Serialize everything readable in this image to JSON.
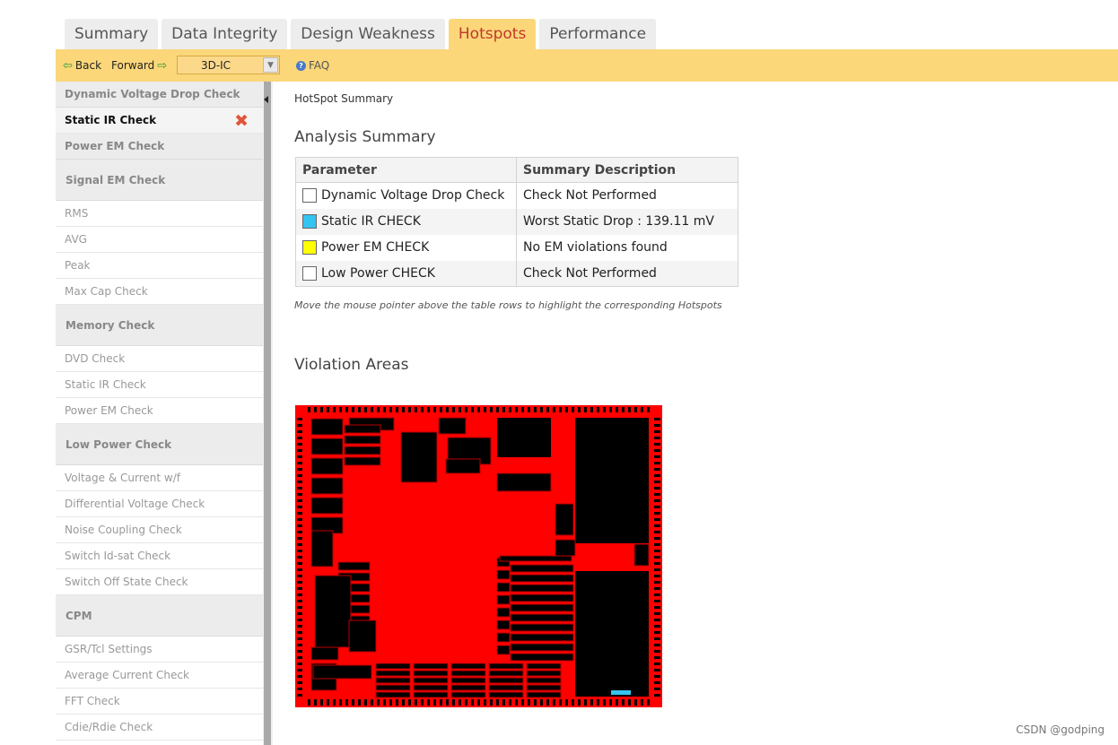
{
  "tabs": [
    "Summary",
    "Data Integrity",
    "Design Weakness",
    "Hotspots",
    "Performance"
  ],
  "active_tab": "Hotspots",
  "toolbar": {
    "back": "Back",
    "forward": "Forward",
    "design_select": "3D-IC",
    "faq": "FAQ"
  },
  "sidebar": {
    "items": [
      {
        "label": "Dynamic Voltage Drop Check",
        "kind": "head"
      },
      {
        "label": "Static IR Check",
        "kind": "active"
      },
      {
        "label": "Power EM Check",
        "kind": "head"
      },
      {
        "label": "Signal EM Check",
        "kind": "head-tall"
      },
      {
        "label": "RMS",
        "kind": "item"
      },
      {
        "label": "AVG",
        "kind": "item"
      },
      {
        "label": "Peak",
        "kind": "item"
      },
      {
        "label": "Max Cap Check",
        "kind": "item"
      },
      {
        "label": "Memory Check",
        "kind": "head-tall"
      },
      {
        "label": "DVD Check",
        "kind": "item"
      },
      {
        "label": "Static IR Check",
        "kind": "item"
      },
      {
        "label": "Power EM Check",
        "kind": "item"
      },
      {
        "label": "Low Power Check",
        "kind": "head-tall"
      },
      {
        "label": "Voltage & Current w/f",
        "kind": "item"
      },
      {
        "label": "Differential Voltage Check",
        "kind": "item"
      },
      {
        "label": "Noise Coupling Check",
        "kind": "item"
      },
      {
        "label": "Switch Id-sat Check",
        "kind": "item"
      },
      {
        "label": "Switch Off State Check",
        "kind": "item"
      },
      {
        "label": "CPM",
        "kind": "head-tall"
      },
      {
        "label": "GSR/Tcl Settings",
        "kind": "item"
      },
      {
        "label": "Average Current Check",
        "kind": "item"
      },
      {
        "label": "FFT Check",
        "kind": "item"
      },
      {
        "label": "Cdie/Rdie Check",
        "kind": "item"
      }
    ]
  },
  "main": {
    "hotspot_title": "HotSpot Summary",
    "analysis_title": "Analysis Summary",
    "table": {
      "headers": [
        "Parameter",
        "Summary Description"
      ],
      "rows": [
        {
          "param": "Dynamic Voltage Drop Check",
          "desc": "Check Not Performed",
          "color": "#ffffff"
        },
        {
          "param": "Static IR CHECK",
          "desc": "Worst Static Drop : 139.11 mV",
          "color": "#35c4f0"
        },
        {
          "param": "Power EM CHECK",
          "desc": "No EM violations found",
          "color": "#ffff00"
        },
        {
          "param": "Low Power CHECK",
          "desc": "Check Not Performed",
          "color": "#ffffff"
        }
      ]
    },
    "note": "Move the mouse pointer above the table rows to highlight the corresponding Hotspots",
    "violation_title": "Violation Areas"
  },
  "colors": {
    "toolbar_bg": "#fbd77a",
    "active_tab_text": "#c0392b",
    "hotspot_red": "#ff0000"
  },
  "watermark": "CSDN @godping"
}
